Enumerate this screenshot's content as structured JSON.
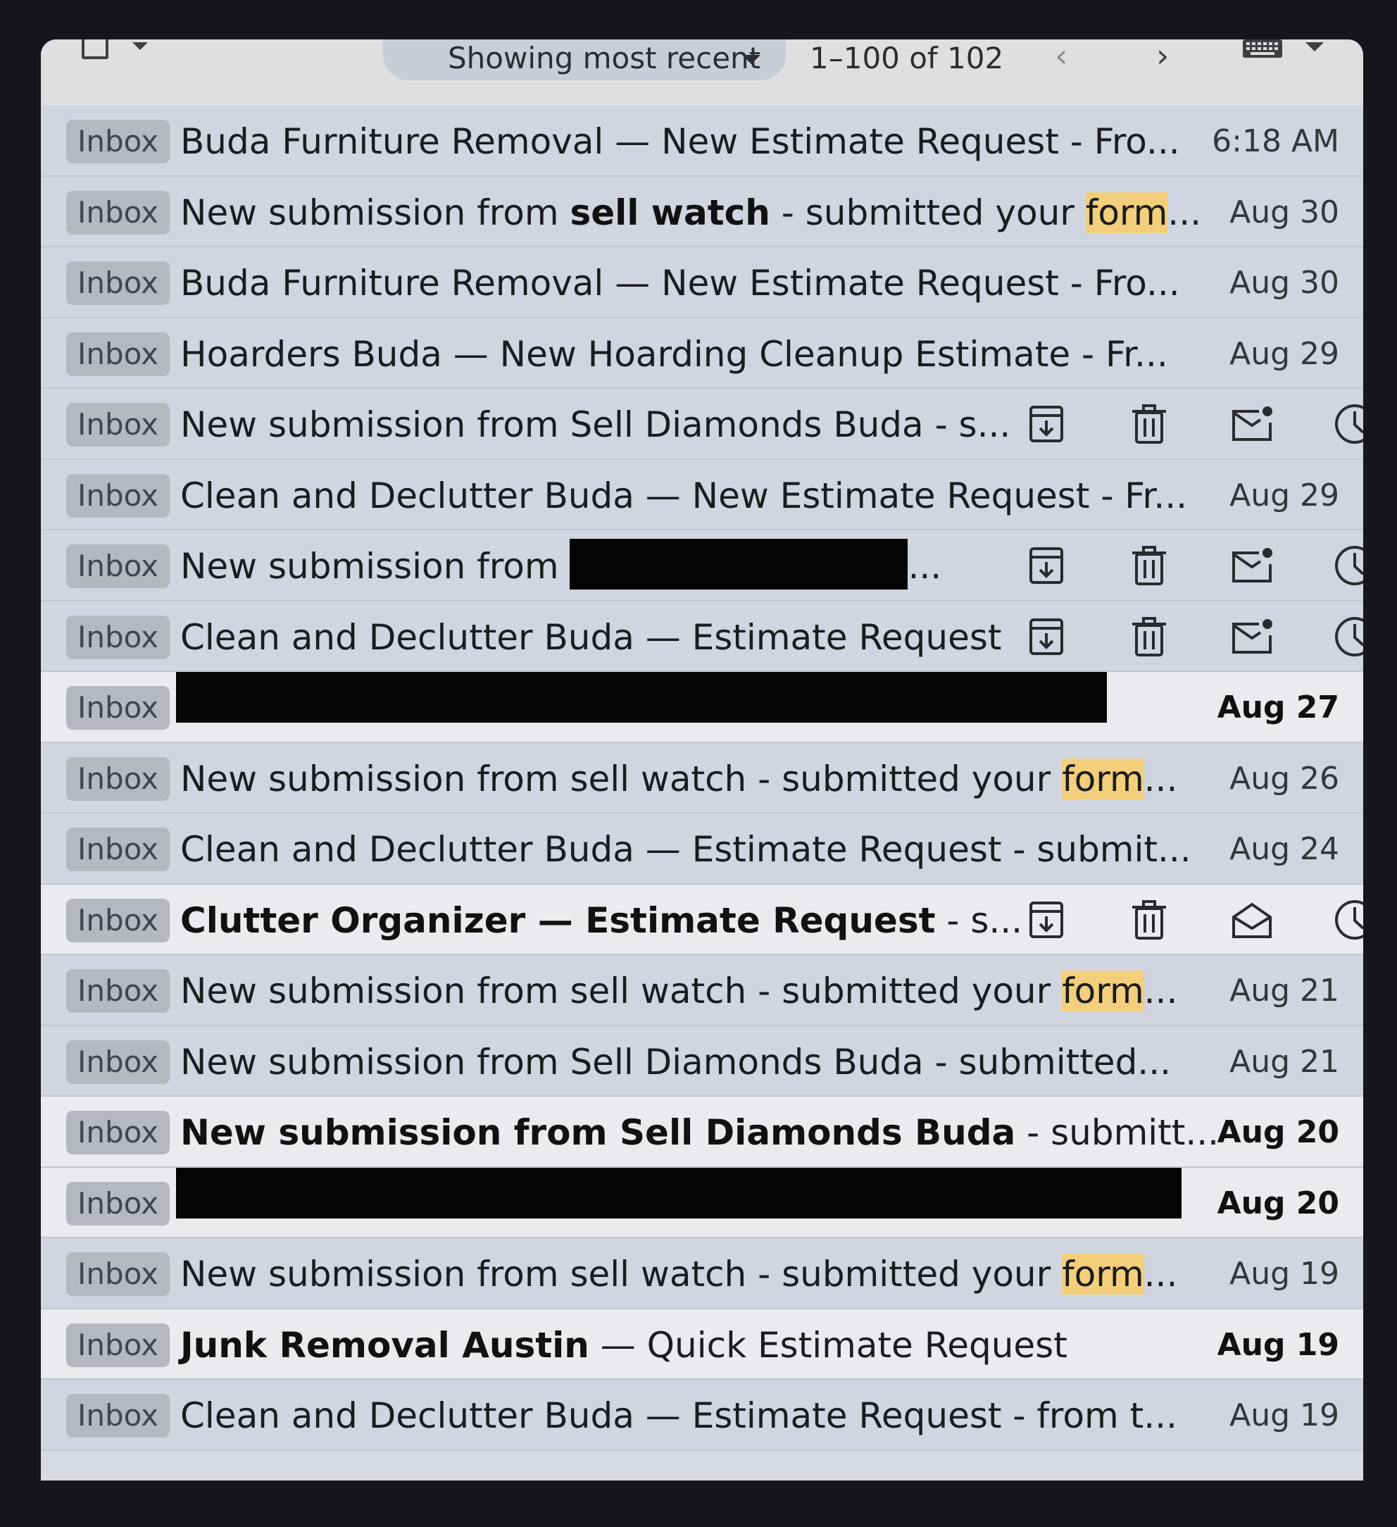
{
  "toolbar": {
    "filter_label": "Showing most recent",
    "pagination": "1–100 of 102",
    "prev": "‹",
    "next": "›"
  },
  "icons": {
    "archive": "archive-icon",
    "delete": "trash-icon",
    "mark_unread": "mark-unread-icon",
    "mark_read": "mark-read-icon",
    "snooze": "clock-icon"
  },
  "colors": {
    "highlight": "#f3cf7c",
    "row_read": "#d0d5e0",
    "row_unread": "#eaebee",
    "badge": "#b5b8bf"
  },
  "emails": [
    {
      "label": "Inbox",
      "sender": "Buda Furniture Removal — New Estimate Request - Fro...",
      "date": "6:18 AM"
    },
    {
      "label": "Inbox",
      "pre": "New submission from ",
      "bold": "sell watch",
      "mid": " - submitted your ",
      "hl": "form",
      "post": "...",
      "date": "Aug 30"
    },
    {
      "label": "Inbox",
      "sender": "Buda Furniture Removal — New Estimate Request - Fro...",
      "date": "Aug 30"
    },
    {
      "label": "Inbox",
      "sender": "Hoarders Buda — New Hoarding Cleanup Estimate - Fr...",
      "date": "Aug 29"
    },
    {
      "label": "Inbox",
      "sender": "New submission from Sell Diamonds Buda - s..."
    },
    {
      "label": "Inbox",
      "sender": "Clean and Declutter Buda — New Estimate Request - Fr...",
      "date": "Aug 29"
    },
    {
      "label": "Inbox",
      "pre": "New submission from ",
      "post": "..."
    },
    {
      "label": "Inbox",
      "sender": "Clean and Declutter Buda — Estimate Request"
    },
    {
      "label": "Inbox",
      "date": "Aug 27"
    },
    {
      "label": "Inbox",
      "pre": "New submission from sell watch - submitted your ",
      "hl": "form",
      "post": "...",
      "date": "Aug 26"
    },
    {
      "label": "Inbox",
      "sender": "Clean and Declutter Buda — Estimate Request - submit...",
      "date": "Aug 24"
    },
    {
      "label": "Inbox",
      "bold": "Clutter Organizer — Estimate Request",
      "post": " - s..."
    },
    {
      "label": "Inbox",
      "pre": "New submission from sell watch - submitted your ",
      "hl": "form",
      "post": "...",
      "date": "Aug 21"
    },
    {
      "label": "Inbox",
      "sender": "New submission from Sell Diamonds Buda - submitted...",
      "date": "Aug 21"
    },
    {
      "label": "Inbox",
      "bold": "New submission from Sell Diamonds Buda",
      "post": " - submitt...",
      "date": "Aug 20"
    },
    {
      "label": "Inbox",
      "date": "Aug 20"
    },
    {
      "label": "Inbox",
      "pre": "New submission from sell watch - submitted your ",
      "hl": "form",
      "post": "...",
      "date": "Aug 19"
    },
    {
      "label": "Inbox",
      "bold": "Junk Removal Austin",
      "post": " — Quick Estimate Request",
      "date": "Aug 19"
    },
    {
      "label": "Inbox",
      "sender": "Clean and Declutter Buda — Estimate Request - from t...",
      "date": "Aug 19"
    }
  ]
}
